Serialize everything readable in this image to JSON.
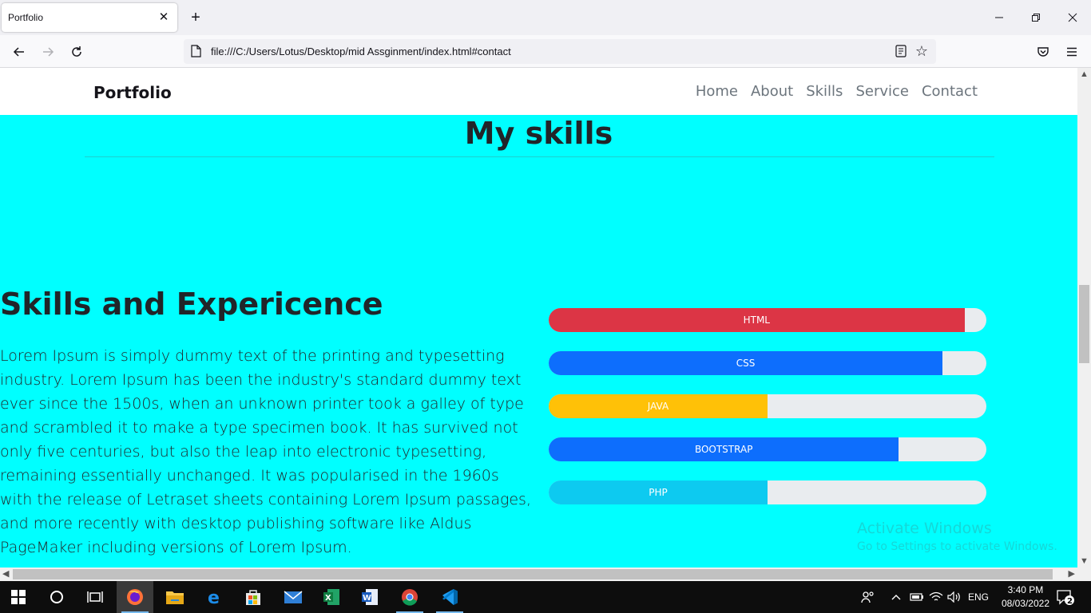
{
  "browser": {
    "tab_title": "Portfolio",
    "url": "file:///C:/Users/Lotus/Desktop/mid Assginment/index.html#contact"
  },
  "site": {
    "brand": "Portfolio",
    "nav": [
      "Home",
      "About",
      "Skills",
      "Service",
      "Contact"
    ],
    "skills_title": "My skills",
    "experience_heading": "Skills and Expericence",
    "experience_text": "Lorem Ipsum is simply dummy text of the printing and typesetting industry. Lorem Ipsum has been the industry's standard dummy text ever since the 1500s, when an unknown printer took a galley of type and scrambled it to make a type specimen book. It has survived not only five centuries, but also the leap into electronic typesetting, remaining essentially unchanged. It was popularised in the 1960s with the release of Letraset sheets containing Lorem Ipsum passages, and more recently with desktop publishing software like Aldus PageMaker including versions of Lorem Ipsum.",
    "skills": [
      {
        "label": "HTML",
        "percent": 95,
        "color": "#dc3545"
      },
      {
        "label": "CSS",
        "percent": 90,
        "color": "#0d6efd"
      },
      {
        "label": "JAVA",
        "percent": 50,
        "color": "#ffc107"
      },
      {
        "label": "BOOTSTRAP",
        "percent": 80,
        "color": "#0d6efd"
      },
      {
        "label": "PHP",
        "percent": 50,
        "color": "#0dcaf0"
      }
    ]
  },
  "watermark": {
    "line1": "Activate Windows",
    "line2": "Go to Settings to activate Windows."
  },
  "taskbar": {
    "language": "ENG",
    "time": "3:40 PM",
    "date": "08/03/2022",
    "notification_count": "2"
  }
}
